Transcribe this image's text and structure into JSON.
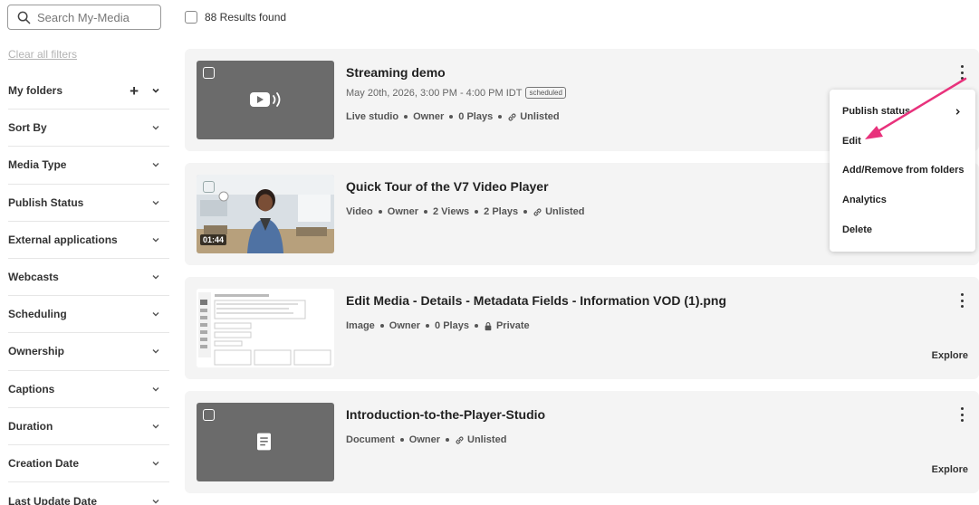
{
  "search": {
    "placeholder": "Search My-Media",
    "value": ""
  },
  "clear_filters": "Clear all filters",
  "results": "88 Results found",
  "sidebar": {
    "filters": [
      {
        "label": "My folders",
        "has_add": true
      },
      {
        "label": "Sort By"
      },
      {
        "label": "Media Type"
      },
      {
        "label": "Publish Status"
      },
      {
        "label": "External applications"
      },
      {
        "label": "Webcasts"
      },
      {
        "label": "Scheduling"
      },
      {
        "label": "Ownership"
      },
      {
        "label": "Captions"
      },
      {
        "label": "Duration"
      },
      {
        "label": "Creation Date"
      },
      {
        "label": "Last Update Date"
      }
    ]
  },
  "media": [
    {
      "title": "Streaming demo",
      "date": "May 20th, 2026, 3:00 PM - 4:00 PM IDT",
      "badge": "scheduled",
      "meta": [
        "Live studio",
        "Owner",
        "0 Plays",
        "Unlisted"
      ],
      "icon": "live-stream-icon"
    },
    {
      "title": "Quick Tour of the V7 Video Player",
      "duration": "01:44",
      "meta": [
        "Video",
        "Owner",
        "2 Views",
        "2 Plays",
        "Unlisted"
      ]
    },
    {
      "title": "Edit Media - Details - Metadata Fields - Information VOD (1).png",
      "meta": [
        "Image",
        "Owner",
        "0 Plays",
        "Private"
      ],
      "action": "Explore"
    },
    {
      "title": "Introduction-to-the-Player-Studio",
      "meta": [
        "Document",
        "Owner",
        "Unlisted"
      ],
      "action": "Explore",
      "icon": "document-icon"
    }
  ],
  "menu": {
    "items": [
      "Publish status",
      "Edit",
      "Add/Remove from folders",
      "Analytics",
      "Delete"
    ]
  },
  "colors": {
    "annotation_arrow": "#e8327c",
    "card_bg": "#f4f4f4",
    "thumb_bg": "#6b6b6b"
  }
}
